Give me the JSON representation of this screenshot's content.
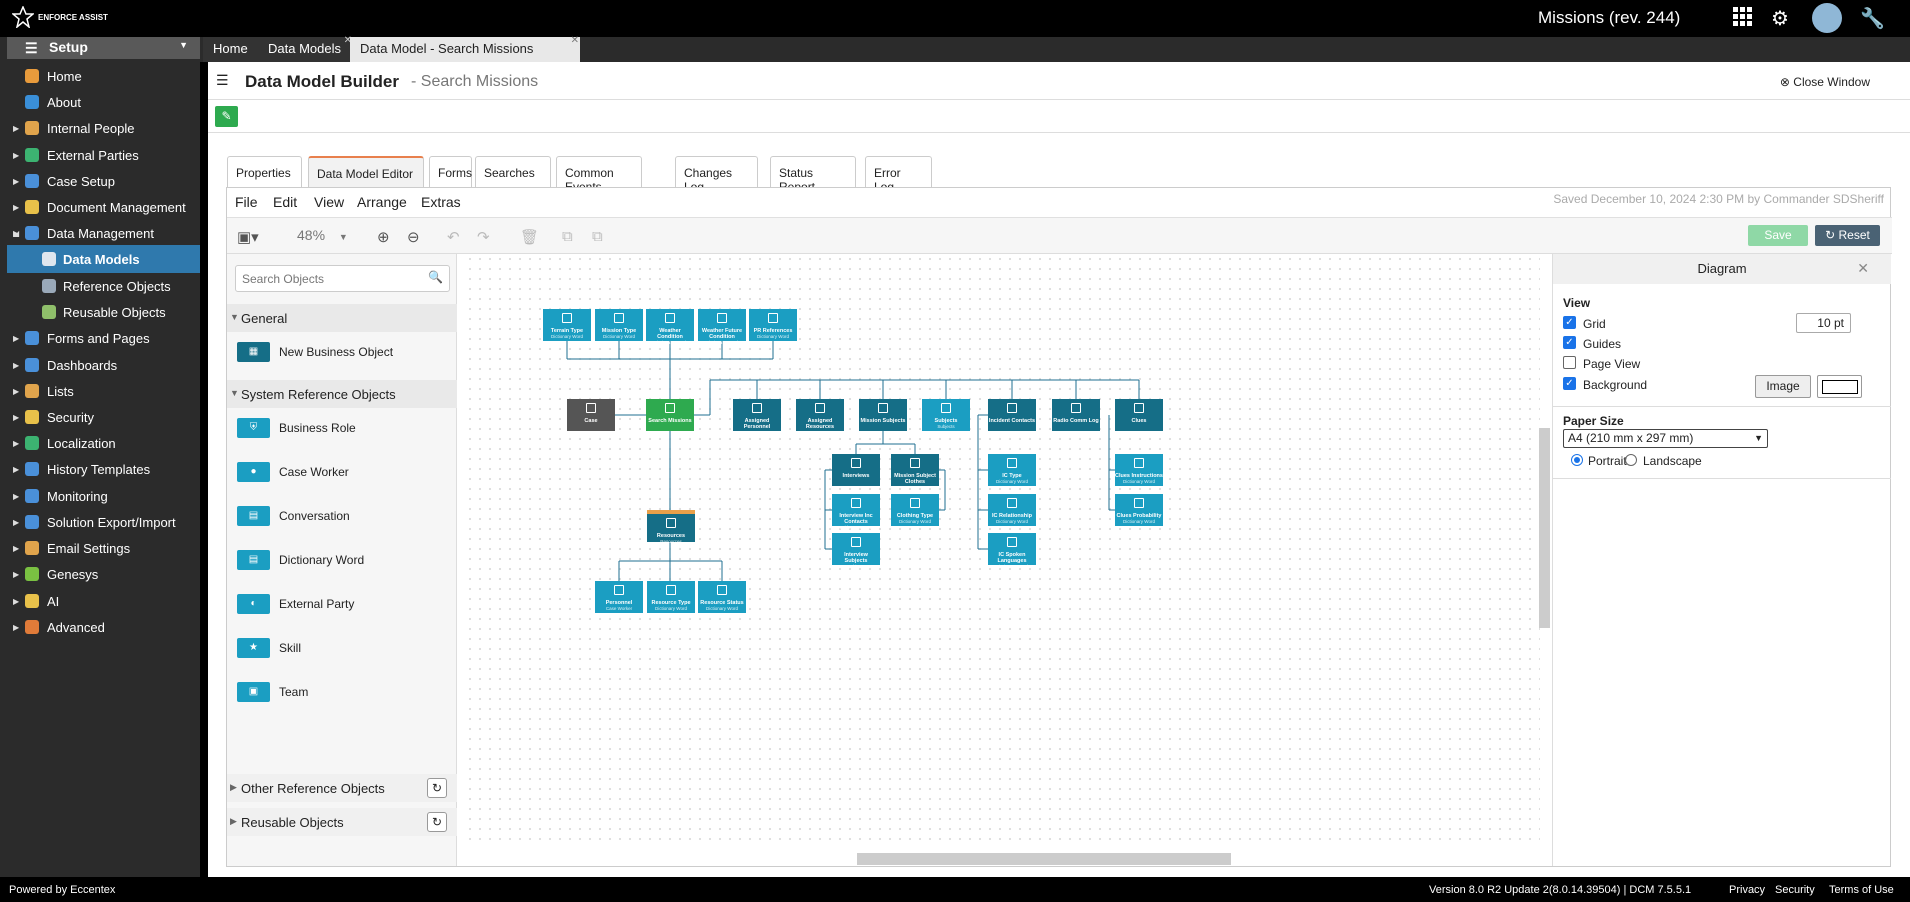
{
  "brand": {
    "logo_text": "ENFORCE ASSIST"
  },
  "top": {
    "app_title": "Missions (rev. 244)",
    "icons": [
      "grid-icon",
      "gear-icon",
      "avatar",
      "wrench-icon"
    ]
  },
  "sidebar": {
    "setup_label": "Setup",
    "items": [
      {
        "label": "Home",
        "icon": "home-icon"
      },
      {
        "label": "About",
        "icon": "info-icon"
      },
      {
        "label": "Internal People",
        "icon": "people-icon"
      },
      {
        "label": "External Parties",
        "icon": "globe-icon"
      },
      {
        "label": "Case Setup",
        "icon": "case-icon"
      },
      {
        "label": "Document Management",
        "icon": "document-icon"
      },
      {
        "label": "Data Management",
        "icon": "table-icon"
      },
      {
        "label": "Data Models",
        "icon": "database-icon"
      },
      {
        "label": "Reference Objects",
        "icon": "reference-icon"
      },
      {
        "label": "Reusable Objects",
        "icon": "reusable-icon"
      },
      {
        "label": "Forms and Pages",
        "icon": "forms-icon"
      },
      {
        "label": "Dashboards",
        "icon": "dashboard-icon"
      },
      {
        "label": "Lists",
        "icon": "list-icon"
      },
      {
        "label": "Security",
        "icon": "lock-icon"
      },
      {
        "label": "Localization",
        "icon": "globe-icon"
      },
      {
        "label": "History Templates",
        "icon": "history-icon"
      },
      {
        "label": "Monitoring",
        "icon": "monitor-icon"
      },
      {
        "label": "Solution Export/Import",
        "icon": "export-icon"
      },
      {
        "label": "Email Settings",
        "icon": "email-icon"
      },
      {
        "label": "Genesys",
        "icon": "puzzle-icon"
      },
      {
        "label": "AI",
        "icon": "ai-icon"
      },
      {
        "label": "Advanced",
        "icon": "wrench-icon"
      }
    ]
  },
  "tabs": [
    {
      "label": "Home"
    },
    {
      "label": "Data Models"
    },
    {
      "label": "Data Model - Search Missions"
    }
  ],
  "header": {
    "title": "Data Model Builder",
    "subtitle": "- Search Missions",
    "close": "Close Window"
  },
  "page_tabs": [
    "Properties",
    "Data Model Editor",
    "Forms",
    "Searches",
    "Common Events",
    "Changes Log",
    "Status Report",
    "Error Log"
  ],
  "menu": [
    "File",
    "Edit",
    "View",
    "Arrange",
    "Extras"
  ],
  "saved_text": "Saved December 10, 2024 2:30 PM by Commander SDSheriff",
  "toolbar": {
    "zoom": "48%",
    "save": "Save",
    "reset": "Reset"
  },
  "left": {
    "search_placeholder": "Search Objects",
    "general": "General",
    "new_business_object": "New Business Object",
    "system_refs": "System Reference Objects",
    "system_items": [
      "Business Role",
      "Case Worker",
      "Conversation",
      "Dictionary Word",
      "External Party",
      "Skill",
      "Team"
    ],
    "other_refs": "Other Reference Objects",
    "reusable": "Reusable Objects"
  },
  "diagram": {
    "nodes": [
      {
        "t": "Terrain Type",
        "s": "Dictionary Word"
      },
      {
        "t": "Mission Type",
        "s": "Dictionary Word"
      },
      {
        "t": "Weather Condition",
        "s": "Dictionary Word"
      },
      {
        "t": "Weather Future Condition",
        "s": "Dictionary Word"
      },
      {
        "t": "PR References",
        "s": "Dictionary Word"
      },
      {
        "t": "Case",
        "s": ""
      },
      {
        "t": "Search Missions",
        "s": ""
      },
      {
        "t": "Assigned Personnel",
        "s": ""
      },
      {
        "t": "Assigned Resources",
        "s": ""
      },
      {
        "t": "Mission Subjects",
        "s": ""
      },
      {
        "t": "Subjects",
        "s": "Subjects"
      },
      {
        "t": "Incident Contacts",
        "s": ""
      },
      {
        "t": "Radio Comm Log",
        "s": ""
      },
      {
        "t": "Clues",
        "s": ""
      },
      {
        "t": "Interviews",
        "s": ""
      },
      {
        "t": "Mission Subject Clothes",
        "s": ""
      },
      {
        "t": "Interview Inc Contacts",
        "s": "Incident Contacts"
      },
      {
        "t": "Clothing Type",
        "s": "Dictionary Word"
      },
      {
        "t": "Interview Subjects",
        "s": "Subjects"
      },
      {
        "t": "IC Type",
        "s": "Dictionary Word"
      },
      {
        "t": "IC Relationship",
        "s": "Dictionary Word"
      },
      {
        "t": "IC Spoken Languages",
        "s": "Dictionary Word"
      },
      {
        "t": "Clues Instructions",
        "s": "Dictionary Word"
      },
      {
        "t": "Clues Probability",
        "s": "Dictionary Word"
      },
      {
        "t": "Resources",
        "s": "Resources"
      },
      {
        "t": "Personnel",
        "s": "Case Worker"
      },
      {
        "t": "Resource Type",
        "s": "Dictionary Word"
      },
      {
        "t": "Resource Status",
        "s": "Dictionary Word"
      }
    ]
  },
  "right": {
    "title": "Diagram",
    "view": "View",
    "grid": "Grid",
    "grid_size": "10 pt",
    "guides": "Guides",
    "page_view": "Page View",
    "background": "Background",
    "image": "Image",
    "paper_size": "Paper Size",
    "paper_value": "A4 (210 mm x 297 mm)",
    "portrait": "Portrait",
    "landscape": "Landscape"
  },
  "footer": {
    "powered": "Powered by Eccentex",
    "version": "Version   8.0 R2 Update 2(8.0.14.39504) | DCM 7.5.5.1",
    "privacy": "Privacy",
    "security": "Security",
    "terms": "Terms of Use"
  }
}
